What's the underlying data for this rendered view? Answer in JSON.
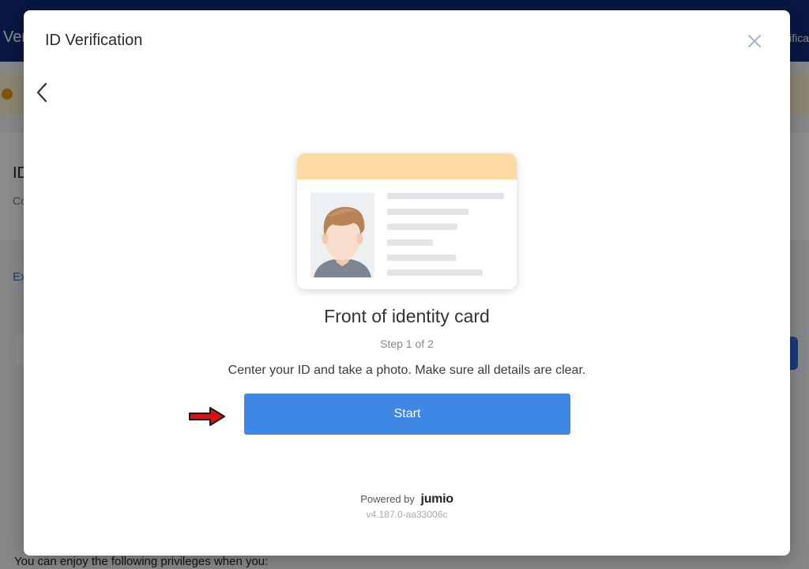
{
  "background": {
    "header_title": "Ver",
    "header_right": "ifica",
    "card_title": "ID",
    "card_sub": "Co",
    "link_text": "Ex",
    "footer_text": "You can enjoy the following privileges when you:"
  },
  "modal": {
    "title": "ID Verification",
    "close_icon": "close-icon",
    "back_icon": "chevron-left-icon"
  },
  "document": {
    "heading": "Front of identity card",
    "step": "Step 1 of 2",
    "instruction": "Center your ID and take a photo. Make sure all details are clear.",
    "start_label": "Start"
  },
  "footer": {
    "powered_by": "Powered by",
    "brand": "jumio",
    "version": "v4.187.0-aa33006c"
  },
  "colors": {
    "accent": "#3f87e5",
    "header": "#0f2a7a",
    "card_band": "#fdd9a3",
    "annotation_arrow": "#d41414"
  }
}
